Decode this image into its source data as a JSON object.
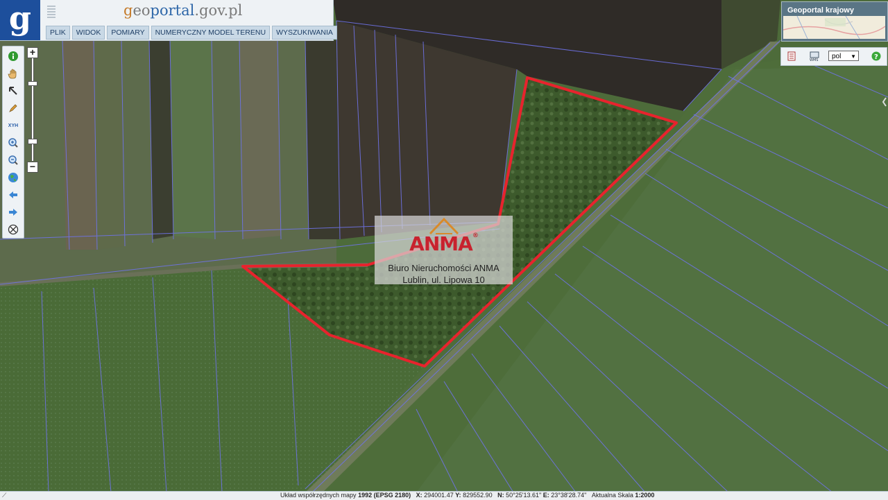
{
  "header": {
    "logo_letter": "g",
    "site_title_parts": [
      "g",
      "eo",
      "portal",
      ".gov.pl"
    ],
    "menu": [
      "PLIK",
      "WIDOK",
      "POMIARY",
      "NUMERYCZNY MODEL TERENU",
      "WYSZUKIWANIA"
    ]
  },
  "toolbar": {
    "tools": [
      {
        "name": "info-icon"
      },
      {
        "name": "pan-hand-icon"
      },
      {
        "name": "select-arrow-icon"
      },
      {
        "name": "pencil-icon"
      },
      {
        "name": "xyh-icon",
        "label": "XYH"
      },
      {
        "name": "zoom-in-icon"
      },
      {
        "name": "zoom-out-icon"
      },
      {
        "name": "globe-icon"
      },
      {
        "name": "back-arrow-icon"
      },
      {
        "name": "forward-arrow-icon"
      },
      {
        "name": "clear-icon"
      }
    ]
  },
  "zoom": {
    "plus": "+",
    "minus": "−"
  },
  "overview": {
    "label": "Geoportal krajowy"
  },
  "right_controls": {
    "language": "pol"
  },
  "watermark": {
    "logo_text": "ANMA",
    "reg_mark": "®",
    "line1": "Biuro Nieruchomości ANMA",
    "line2": "Lublin, ul. Lipowa 10"
  },
  "status": {
    "crs_label": "Układ współrzędnych mapy",
    "crs_value": "1992 (EPSG 2180)",
    "x_label": "X:",
    "x_value": "294001.47",
    "y_label": "Y:",
    "y_value": "829552.90",
    "n_label": "N:",
    "n_value": "50°25'13.61\"",
    "e_label": "E:",
    "e_value": "23°38'28.74\"",
    "scale_label": "Aktualna Skala",
    "scale_value": "1:2000"
  },
  "colors": {
    "parcel_outline": "#e8232d",
    "parcel_lines": "#6f73e8",
    "header_bg": "#eef2f5",
    "logo_bg": "#1d4f9c"
  }
}
